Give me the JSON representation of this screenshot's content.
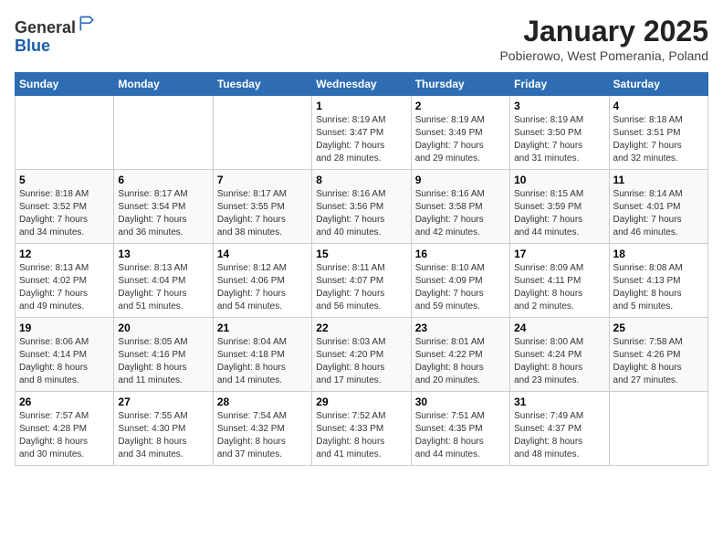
{
  "header": {
    "logo_line1": "General",
    "logo_line2": "Blue",
    "title": "January 2025",
    "subtitle": "Pobierowo, West Pomerania, Poland"
  },
  "weekdays": [
    "Sunday",
    "Monday",
    "Tuesday",
    "Wednesday",
    "Thursday",
    "Friday",
    "Saturday"
  ],
  "weeks": [
    [
      {
        "day": "",
        "info": ""
      },
      {
        "day": "",
        "info": ""
      },
      {
        "day": "",
        "info": ""
      },
      {
        "day": "1",
        "info": "Sunrise: 8:19 AM\nSunset: 3:47 PM\nDaylight: 7 hours\nand 28 minutes."
      },
      {
        "day": "2",
        "info": "Sunrise: 8:19 AM\nSunset: 3:49 PM\nDaylight: 7 hours\nand 29 minutes."
      },
      {
        "day": "3",
        "info": "Sunrise: 8:19 AM\nSunset: 3:50 PM\nDaylight: 7 hours\nand 31 minutes."
      },
      {
        "day": "4",
        "info": "Sunrise: 8:18 AM\nSunset: 3:51 PM\nDaylight: 7 hours\nand 32 minutes."
      }
    ],
    [
      {
        "day": "5",
        "info": "Sunrise: 8:18 AM\nSunset: 3:52 PM\nDaylight: 7 hours\nand 34 minutes."
      },
      {
        "day": "6",
        "info": "Sunrise: 8:17 AM\nSunset: 3:54 PM\nDaylight: 7 hours\nand 36 minutes."
      },
      {
        "day": "7",
        "info": "Sunrise: 8:17 AM\nSunset: 3:55 PM\nDaylight: 7 hours\nand 38 minutes."
      },
      {
        "day": "8",
        "info": "Sunrise: 8:16 AM\nSunset: 3:56 PM\nDaylight: 7 hours\nand 40 minutes."
      },
      {
        "day": "9",
        "info": "Sunrise: 8:16 AM\nSunset: 3:58 PM\nDaylight: 7 hours\nand 42 minutes."
      },
      {
        "day": "10",
        "info": "Sunrise: 8:15 AM\nSunset: 3:59 PM\nDaylight: 7 hours\nand 44 minutes."
      },
      {
        "day": "11",
        "info": "Sunrise: 8:14 AM\nSunset: 4:01 PM\nDaylight: 7 hours\nand 46 minutes."
      }
    ],
    [
      {
        "day": "12",
        "info": "Sunrise: 8:13 AM\nSunset: 4:02 PM\nDaylight: 7 hours\nand 49 minutes."
      },
      {
        "day": "13",
        "info": "Sunrise: 8:13 AM\nSunset: 4:04 PM\nDaylight: 7 hours\nand 51 minutes."
      },
      {
        "day": "14",
        "info": "Sunrise: 8:12 AM\nSunset: 4:06 PM\nDaylight: 7 hours\nand 54 minutes."
      },
      {
        "day": "15",
        "info": "Sunrise: 8:11 AM\nSunset: 4:07 PM\nDaylight: 7 hours\nand 56 minutes."
      },
      {
        "day": "16",
        "info": "Sunrise: 8:10 AM\nSunset: 4:09 PM\nDaylight: 7 hours\nand 59 minutes."
      },
      {
        "day": "17",
        "info": "Sunrise: 8:09 AM\nSunset: 4:11 PM\nDaylight: 8 hours\nand 2 minutes."
      },
      {
        "day": "18",
        "info": "Sunrise: 8:08 AM\nSunset: 4:13 PM\nDaylight: 8 hours\nand 5 minutes."
      }
    ],
    [
      {
        "day": "19",
        "info": "Sunrise: 8:06 AM\nSunset: 4:14 PM\nDaylight: 8 hours\nand 8 minutes."
      },
      {
        "day": "20",
        "info": "Sunrise: 8:05 AM\nSunset: 4:16 PM\nDaylight: 8 hours\nand 11 minutes."
      },
      {
        "day": "21",
        "info": "Sunrise: 8:04 AM\nSunset: 4:18 PM\nDaylight: 8 hours\nand 14 minutes."
      },
      {
        "day": "22",
        "info": "Sunrise: 8:03 AM\nSunset: 4:20 PM\nDaylight: 8 hours\nand 17 minutes."
      },
      {
        "day": "23",
        "info": "Sunrise: 8:01 AM\nSunset: 4:22 PM\nDaylight: 8 hours\nand 20 minutes."
      },
      {
        "day": "24",
        "info": "Sunrise: 8:00 AM\nSunset: 4:24 PM\nDaylight: 8 hours\nand 23 minutes."
      },
      {
        "day": "25",
        "info": "Sunrise: 7:58 AM\nSunset: 4:26 PM\nDaylight: 8 hours\nand 27 minutes."
      }
    ],
    [
      {
        "day": "26",
        "info": "Sunrise: 7:57 AM\nSunset: 4:28 PM\nDaylight: 8 hours\nand 30 minutes."
      },
      {
        "day": "27",
        "info": "Sunrise: 7:55 AM\nSunset: 4:30 PM\nDaylight: 8 hours\nand 34 minutes."
      },
      {
        "day": "28",
        "info": "Sunrise: 7:54 AM\nSunset: 4:32 PM\nDaylight: 8 hours\nand 37 minutes."
      },
      {
        "day": "29",
        "info": "Sunrise: 7:52 AM\nSunset: 4:33 PM\nDaylight: 8 hours\nand 41 minutes."
      },
      {
        "day": "30",
        "info": "Sunrise: 7:51 AM\nSunset: 4:35 PM\nDaylight: 8 hours\nand 44 minutes."
      },
      {
        "day": "31",
        "info": "Sunrise: 7:49 AM\nSunset: 4:37 PM\nDaylight: 8 hours\nand 48 minutes."
      },
      {
        "day": "",
        "info": ""
      }
    ]
  ]
}
